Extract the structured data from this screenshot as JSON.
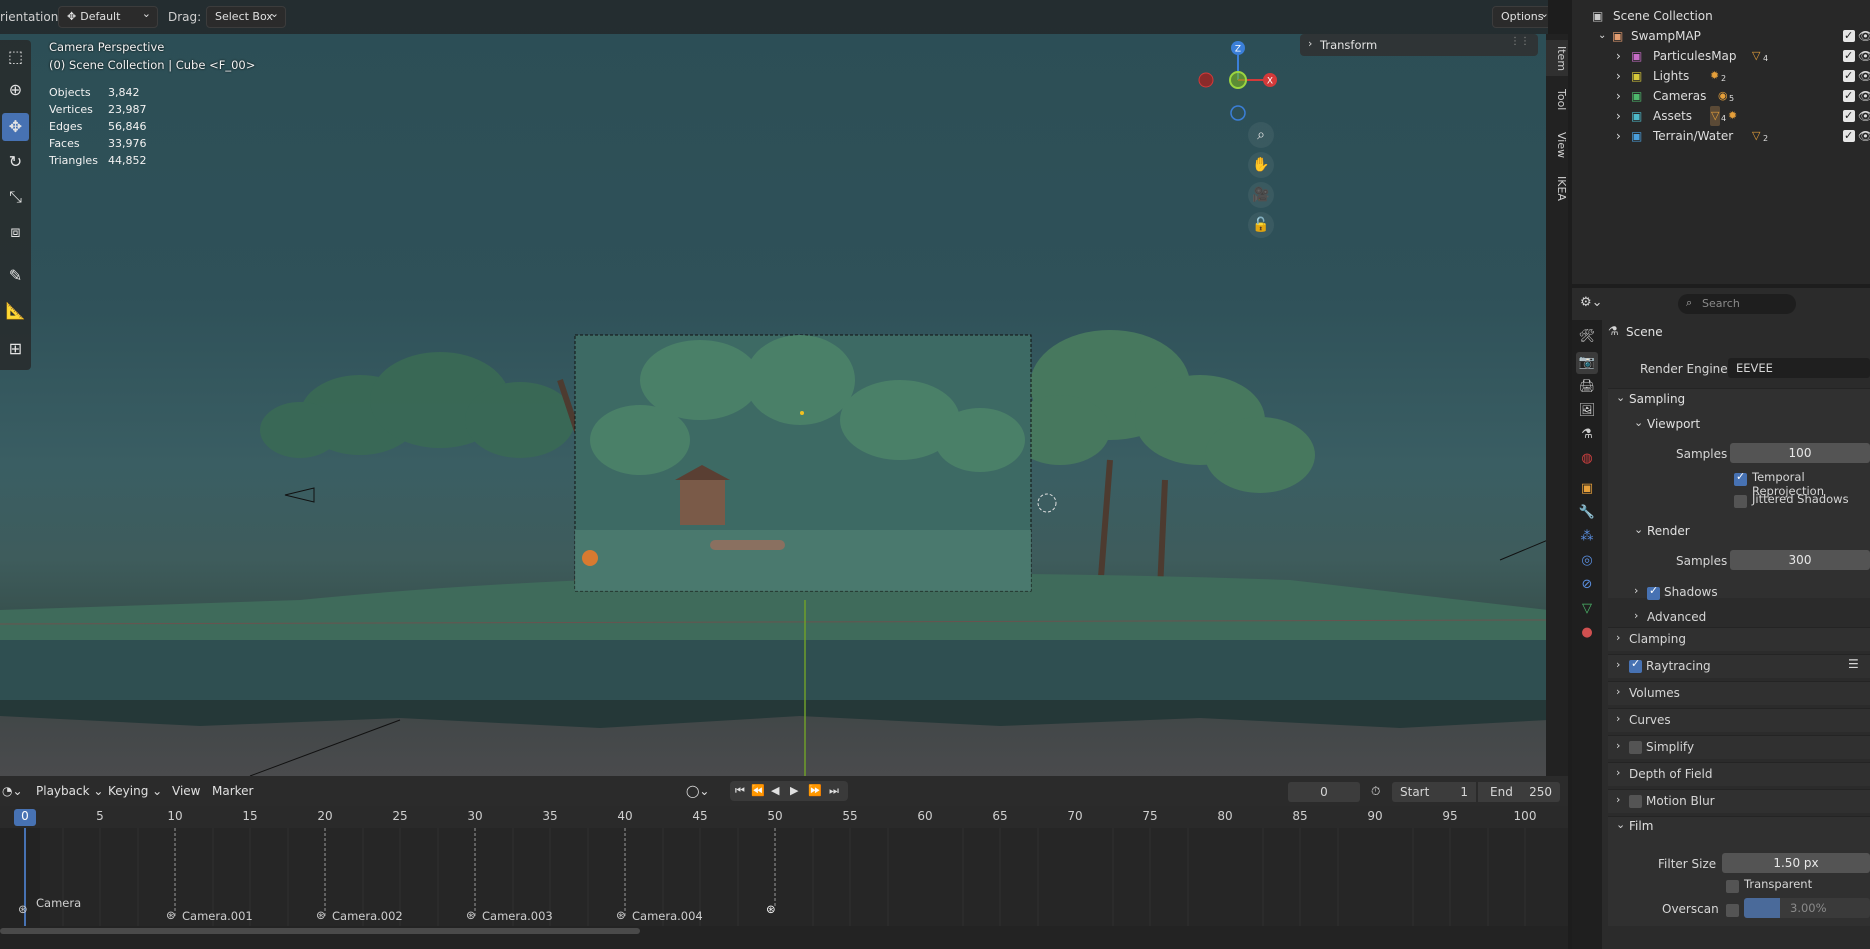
{
  "viewport_header": {
    "orientation_label": "rientation:",
    "orientation_value": "Default",
    "drag_label": "Drag:",
    "drag_value": "Select Box",
    "options_label": "Options"
  },
  "overlay": {
    "view_name": "Camera Perspective",
    "context": "(0) Scene Collection | Cube <F_00>",
    "stats": [
      {
        "label": "Objects",
        "value": "3,842"
      },
      {
        "label": "Vertices",
        "value": "23,987"
      },
      {
        "label": "Edges",
        "value": "56,846"
      },
      {
        "label": "Faces",
        "value": "33,976"
      },
      {
        "label": "Triangles",
        "value": "44,852"
      }
    ]
  },
  "gizmo": {
    "z": "Z",
    "x": "X"
  },
  "sidebar": {
    "transform_label": "Transform"
  },
  "side_tabs": [
    "Item",
    "Tool",
    "View",
    "IKEA"
  ],
  "outliner": {
    "root": "Scene Collection",
    "collection": "SwampMAP",
    "children": [
      {
        "name": "ParticulesMap",
        "color": "#c66bc6",
        "badge": "4"
      },
      {
        "name": "Lights",
        "color": "#d6c73a",
        "badge": "2"
      },
      {
        "name": "Cameras",
        "color": "#4db86b",
        "badge": "5"
      },
      {
        "name": "Assets",
        "color": "#4db8c8",
        "badge": "4"
      },
      {
        "name": "Terrain/Water",
        "color": "#4a9edb",
        "badge": "2"
      }
    ]
  },
  "properties": {
    "search_placeholder": "Search",
    "scene_label": "Scene",
    "render_engine_label": "Render Engine",
    "render_engine_value": "EEVEE",
    "sampling": "Sampling",
    "viewport": "Viewport",
    "samples_label": "Samples",
    "viewport_samples": "100",
    "temporal_reprojection": "Temporal Reprojection",
    "jittered_shadows": "Jittered Shadows",
    "render": "Render",
    "render_samples": "300",
    "shadows": "Shadows",
    "advanced": "Advanced",
    "clamping": "Clamping",
    "raytracing": "Raytracing",
    "volumes": "Volumes",
    "curves": "Curves",
    "simplify": "Simplify",
    "depth_of_field": "Depth of Field",
    "motion_blur": "Motion Blur",
    "film": "Film",
    "filter_size_label": "Filter Size",
    "filter_size_value": "1.50 px",
    "transparent": "Transparent",
    "overscan_label": "Overscan",
    "overscan_value": "3.00%"
  },
  "timeline": {
    "menus": [
      "Playback",
      "Keying",
      "View",
      "Marker"
    ],
    "current_frame": "0",
    "start_label": "Start",
    "start_value": "1",
    "end_label": "End",
    "end_value": "250",
    "ruler": [
      "0",
      "5",
      "10",
      "15",
      "20",
      "25",
      "30",
      "35",
      "40",
      "45",
      "50",
      "55",
      "60",
      "65",
      "70",
      "75",
      "80",
      "85",
      "90",
      "95",
      "100"
    ],
    "markers": [
      "Camera",
      "Camera.001",
      "Camera.002",
      "Camera.003",
      "Camera.004"
    ]
  },
  "colors": {
    "accent": "#4772b3",
    "axis_x": "#d33a3a",
    "axis_y": "#7bb520",
    "axis_z": "#3b7fd8"
  }
}
